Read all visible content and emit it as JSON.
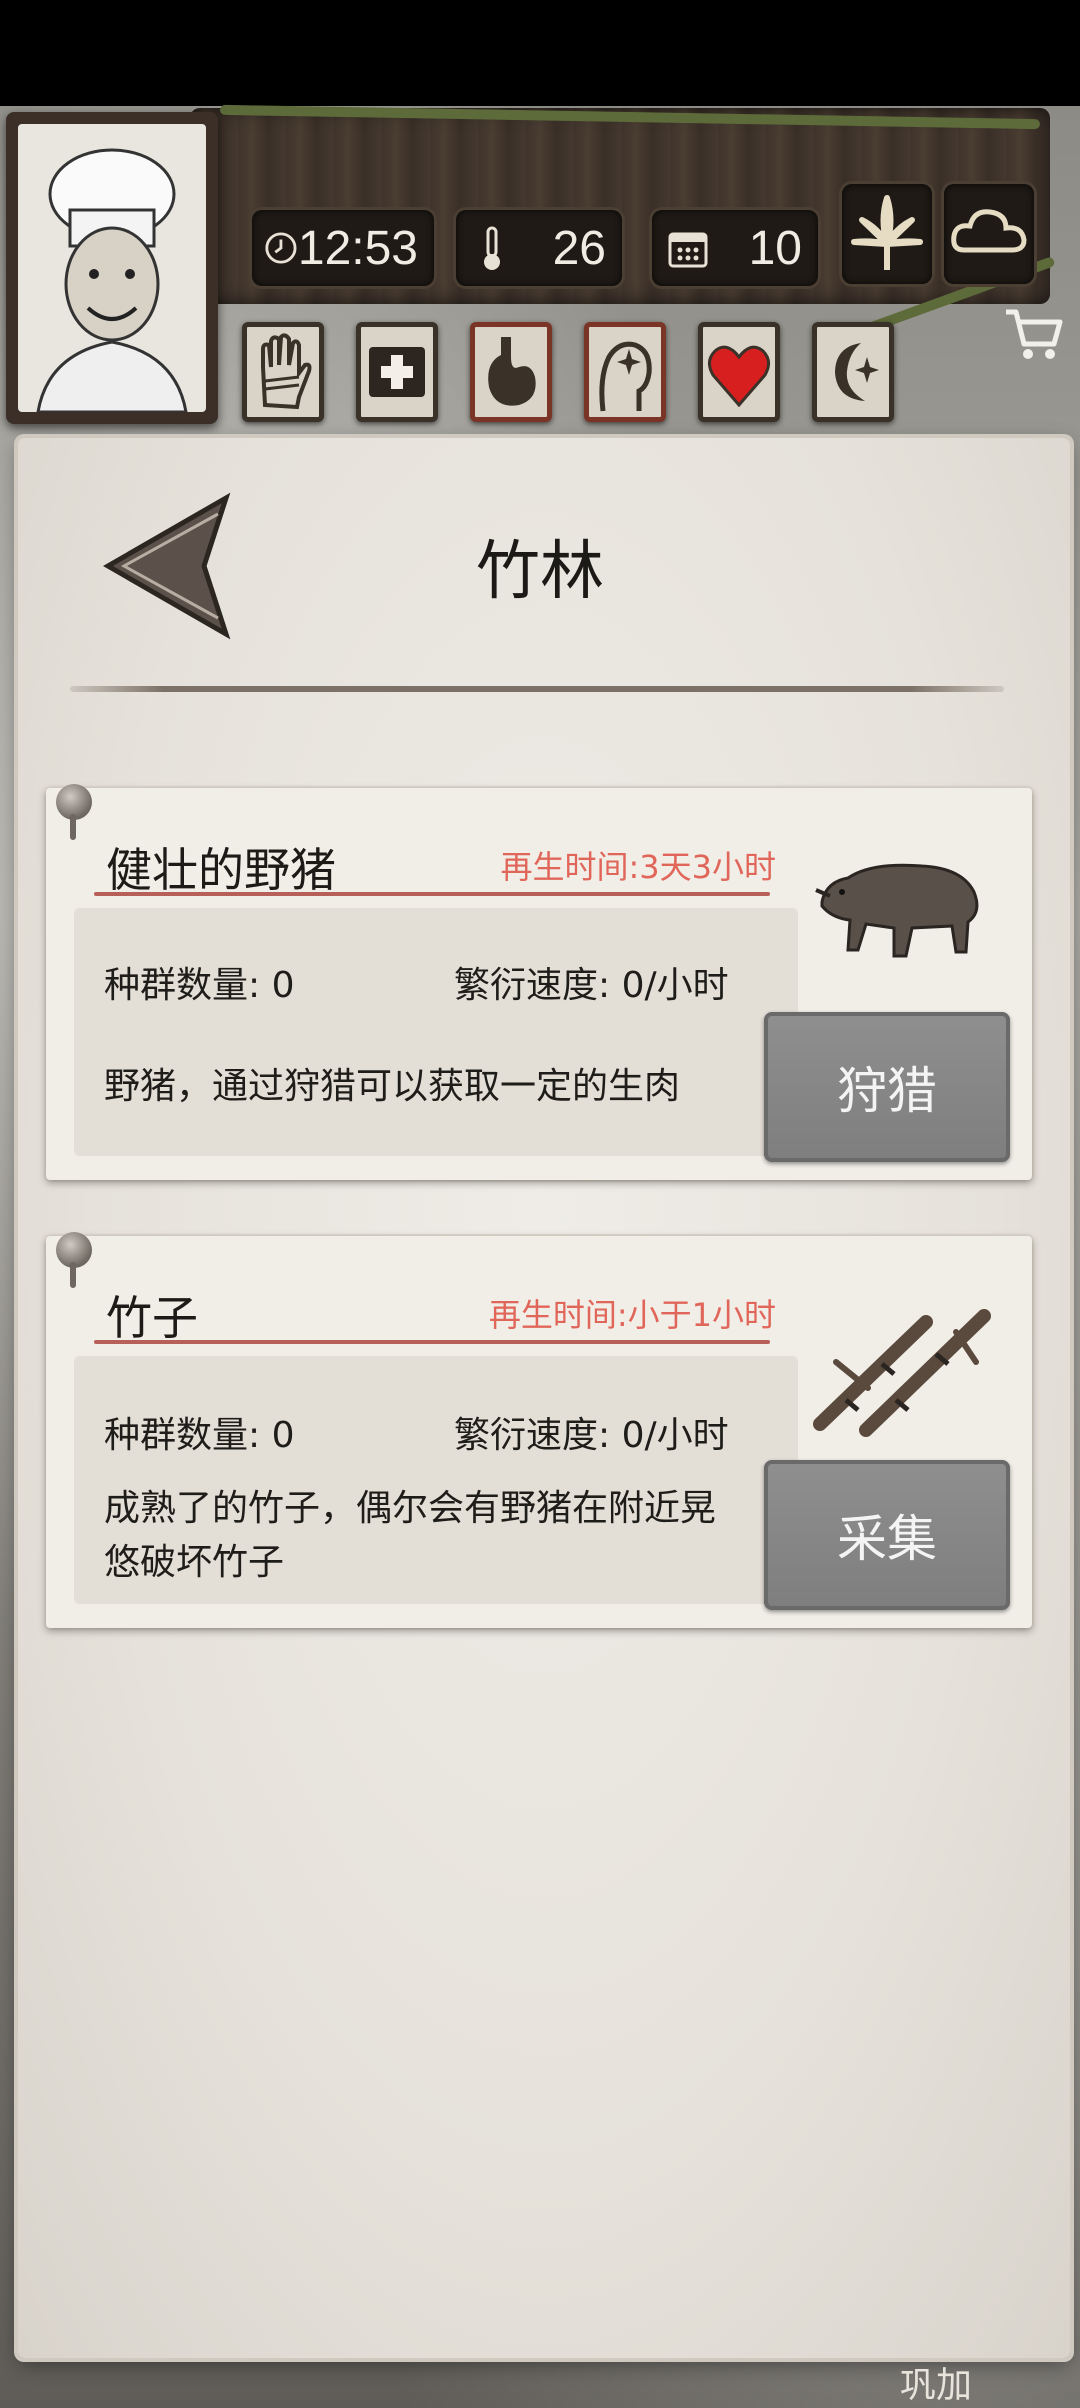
{
  "header": {
    "time": "12:53",
    "temperature": "26",
    "day": "10",
    "season_icon": "cannabis-leaf-icon",
    "weather_icon": "cloud-icon",
    "stats": [
      {
        "name": "hand-bandage-icon",
        "alert": false
      },
      {
        "name": "medical-cross-icon",
        "alert": false
      },
      {
        "name": "stomach-icon",
        "alert": true
      },
      {
        "name": "mind-sparkle-icon",
        "alert": true
      },
      {
        "name": "heart-icon",
        "alert": false,
        "color": "#d81f1f"
      },
      {
        "name": "moon-star-icon",
        "alert": false
      }
    ]
  },
  "page": {
    "title": "竹林"
  },
  "resources": [
    {
      "name": "健壮的野猪",
      "regen": "再生时间:3天3小时",
      "population_label": "种群数量: 0",
      "breed_label": "繁衍速度: 0/小时",
      "description": "野猪，通过狩猎可以获取一定的生肉",
      "action": "狩猎",
      "icon": "boar-icon"
    },
    {
      "name": "竹子",
      "regen": "再生时间:小于1小时",
      "population_label": "种群数量: 0",
      "breed_label": "繁衍速度: 0/小时",
      "description": "成熟了的竹子，偶尔会有野猪在附近晃悠破坏竹子",
      "action": "采集",
      "icon": "bamboo-icon"
    }
  ],
  "colors": {
    "regen_text": "#e1665a",
    "action_button": "#8a8a8a",
    "wood": "#3f342b"
  },
  "footer": {
    "partial_text": "巩加"
  }
}
